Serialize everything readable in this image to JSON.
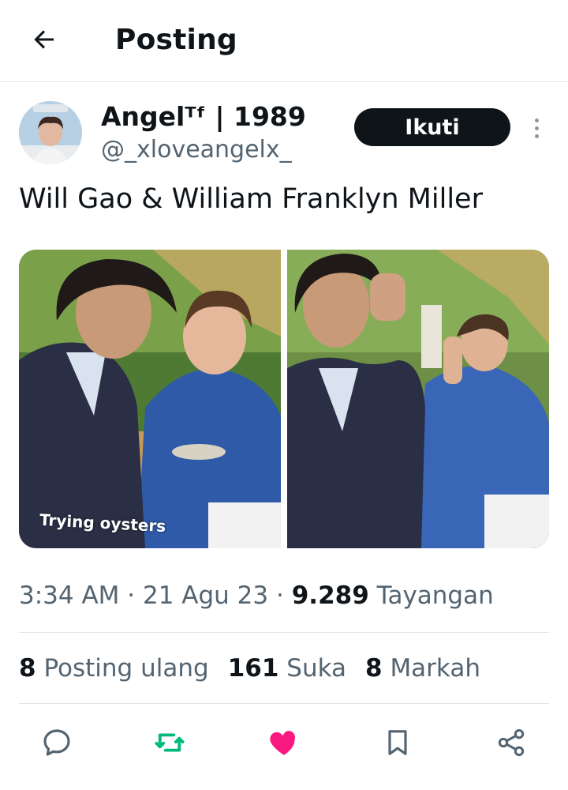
{
  "header": {
    "title": "Posting",
    "back_icon": "arrow-left-icon"
  },
  "author": {
    "display_name": "Angelᵀᶠ | 1989",
    "handle": "@_xloveangelx_",
    "follow_label": "Ikuti"
  },
  "post": {
    "text": "Will Gao & William Franklyn Miller",
    "media_caption": "Trying oysters",
    "time": "3:34 AM",
    "date": "21 Agu 23",
    "views_count": "9.289",
    "views_label": "Tayangan"
  },
  "stats": {
    "reposts_count": "8",
    "reposts_label": "Posting ulang",
    "likes_count": "161",
    "likes_label": "Suka",
    "bookmarks_count": "8",
    "bookmarks_label": "Markah"
  },
  "actions": [
    {
      "icon": "reply-icon",
      "color": "#536471"
    },
    {
      "icon": "repost-icon",
      "color": "#00ba7c"
    },
    {
      "icon": "heart-icon",
      "color": "#f91880"
    },
    {
      "icon": "bookmark-icon",
      "color": "#536471"
    },
    {
      "icon": "share-icon",
      "color": "#536471"
    }
  ]
}
